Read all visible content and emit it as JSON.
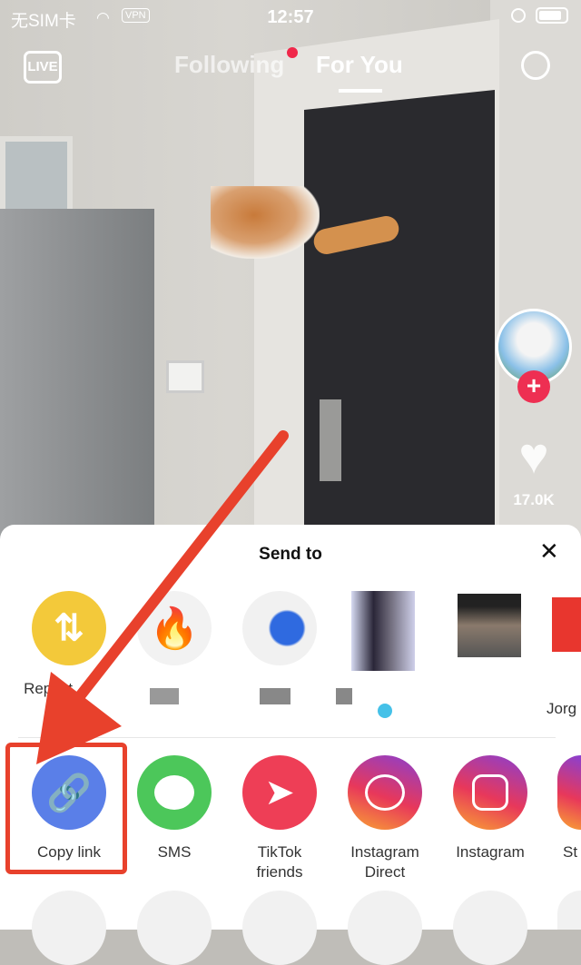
{
  "status_bar": {
    "carrier": "无SIM卡",
    "vpn": "VPN",
    "time": "12:57"
  },
  "top_nav": {
    "live": "LIVE",
    "tabs": [
      {
        "label": "Following",
        "active": false,
        "badge": true
      },
      {
        "label": "For You",
        "active": true
      }
    ]
  },
  "side": {
    "like_count": "17.0K"
  },
  "sheet": {
    "title": "Send to",
    "contacts": [
      {
        "label": "Repost",
        "icon": "repost-icon",
        "color": "#f3c93a"
      },
      {
        "label": ""
      },
      {
        "label": ""
      },
      {
        "label": "",
        "verified": true
      },
      {
        "label": ""
      },
      {
        "label": "Jorg"
      }
    ],
    "share_targets": [
      {
        "label": "Copy link",
        "icon": "link-icon",
        "color": "#5a7fe8",
        "highlighted": true
      },
      {
        "label": "SMS",
        "icon": "message-icon",
        "color": "#4cc75a"
      },
      {
        "label": "TikTok friends",
        "icon": "send-icon",
        "color": "#ee3e56"
      },
      {
        "label": "Instagram Direct",
        "icon": "messenger-icon",
        "color": "#c13bb1"
      },
      {
        "label": "Instagram",
        "icon": "instagram-icon",
        "color": "#c13bb1"
      },
      {
        "label": "St",
        "icon": "stories-icon",
        "color": "#c13bb1"
      }
    ]
  },
  "annotation": {
    "color": "#e8412c"
  }
}
